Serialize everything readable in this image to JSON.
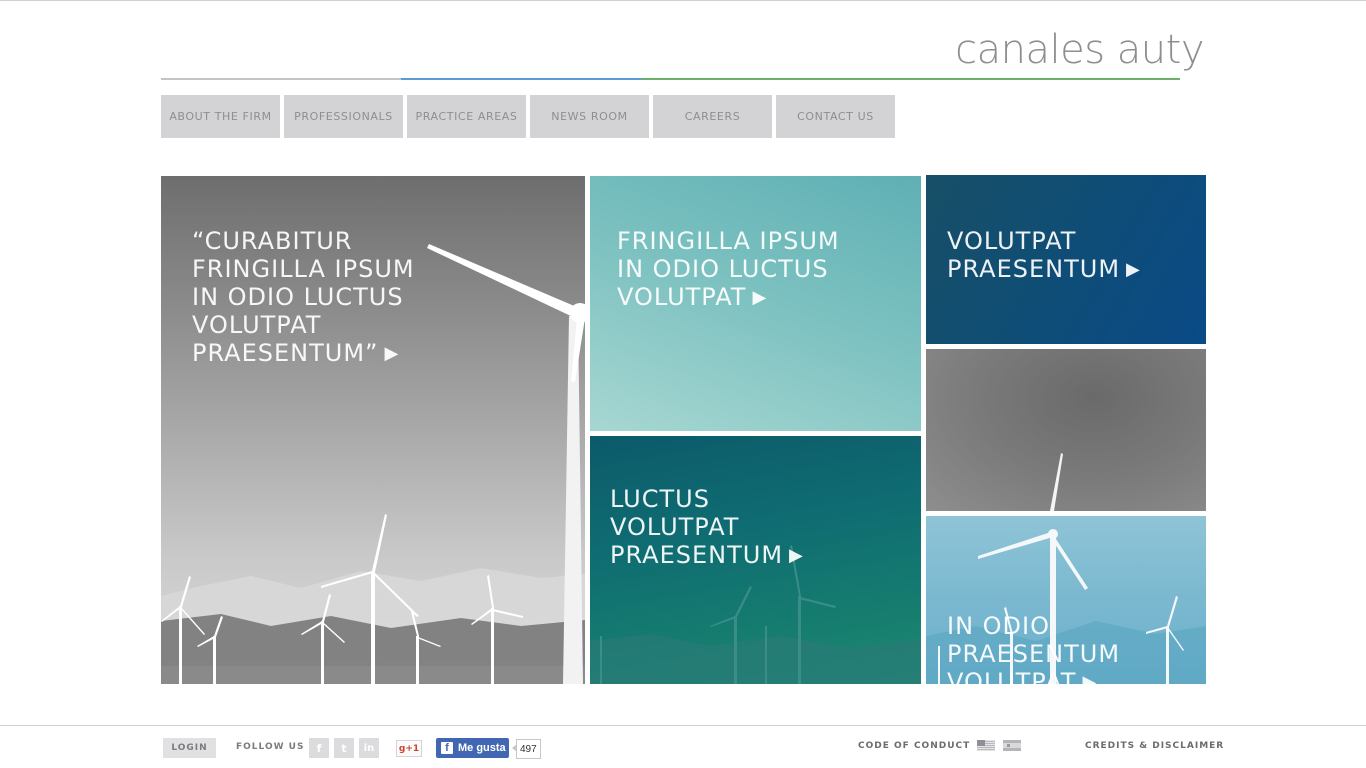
{
  "header": {
    "logo": "canales auty"
  },
  "nav": {
    "items": [
      {
        "label": "ABOUT THE FIRM"
      },
      {
        "label": "PROFESSIONALS"
      },
      {
        "label": "PRACTICE AREAS"
      },
      {
        "label": "NEWS ROOM"
      },
      {
        "label": "CAREERS"
      },
      {
        "label": "CONTACT US"
      }
    ]
  },
  "tiles": {
    "main": "“CURABITUR\nFRINGILLA IPSUM\nIN ODIO LUCTUS\nVOLUTPAT\nPRAESENTUM”",
    "aqua": "FRINGILLA IPSUM\nIN ODIO LUCTUS\nVOLUTPAT",
    "navy": "VOLUTPAT\nPRAESENTUM",
    "teal": "LUCTUS\nVOLUTPAT\nPRAESENTUM",
    "sky": "IN ODIO\nPRAESENTUM\nVOLUTPAT",
    "arrow": "▶"
  },
  "footer": {
    "login": "LOGIN",
    "follow": "FOLLOW US",
    "social": [
      {
        "icon": "facebook-icon",
        "glyph": "f"
      },
      {
        "icon": "twitter-icon",
        "glyph": "t"
      },
      {
        "icon": "linkedin-icon",
        "glyph": "in"
      }
    ],
    "gplus": "g+1",
    "fb_like": "Me gusta",
    "fb_count": "497",
    "code_of_conduct": "CODE OF CONDUCT",
    "credits": "CREDITS & DISCLAIMER"
  },
  "colors": {
    "nav_bg": "#d3d3d6",
    "rule_blue": "#5a9bd4",
    "rule_green": "#6db06a",
    "tile_navy": "#0e4d78",
    "tile_teal": "#0f6d72",
    "tile_aqua": "#7ec2c1",
    "tile_sky": "#7cb9d0",
    "fb_blue": "#4267b2"
  }
}
